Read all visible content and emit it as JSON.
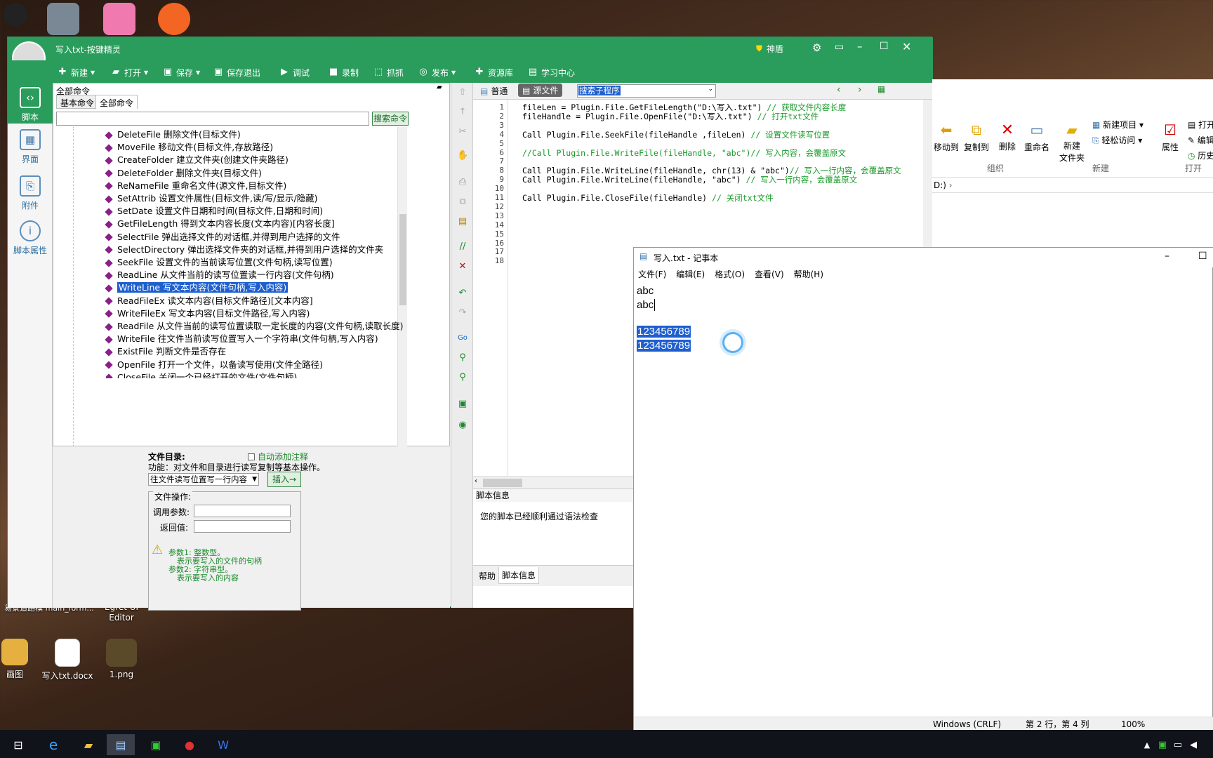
{
  "desktop": {
    "icons": [
      {
        "label": "画图"
      },
      {
        "label": "写入txt.docx"
      },
      {
        "label": "1.png"
      },
      {
        "label": "Egret UI Editor"
      },
      {
        "label": "易景道路模 main_form..."
      }
    ]
  },
  "app": {
    "title": "写入txt-按键精灵",
    "shield_label": "神盾",
    "toolbar": [
      {
        "label": "新建",
        "icon": "plus-icon"
      },
      {
        "label": "打开",
        "icon": "folder-icon"
      },
      {
        "label": "保存",
        "icon": "save-icon"
      },
      {
        "label": "保存退出",
        "icon": "save-exit-icon"
      },
      {
        "label": "调试",
        "icon": "play-icon"
      },
      {
        "label": "录制",
        "icon": "camera-icon"
      },
      {
        "label": "抓抓",
        "icon": "capture-icon"
      },
      {
        "label": "发布",
        "icon": "publish-icon"
      },
      {
        "label": "资源库",
        "icon": "library-icon"
      },
      {
        "label": "学习中心",
        "icon": "learn-icon"
      }
    ],
    "leftbar": [
      {
        "label": "脚本",
        "icon": "script-icon"
      },
      {
        "label": "界面",
        "icon": "ui-icon"
      },
      {
        "label": "附件",
        "icon": "attachment-icon"
      },
      {
        "label": "脚本属性",
        "icon": "info-icon"
      }
    ],
    "cmd_panel": {
      "header": "全部命令",
      "tabs": [
        "基本命令",
        "全部命令"
      ],
      "search_button": "搜索命令",
      "search_value": "",
      "items": [
        "DeleteFile 删除文件(目标文件)",
        "MoveFile 移动文件(目标文件,存放路径)",
        "CreateFolder 建立文件夹(创建文件夹路径)",
        "DeleteFolder 删除文件夹(目标文件)",
        "ReNameFile 重命名文件(源文件,目标文件)",
        "SetAttrib 设置文件属性(目标文件,读/写/显示/隐藏)",
        "SetDate 设置文件日期和时间(目标文件,日期和时间)",
        "GetFileLength 得到文本内容长度(文本内容)[内容长度]",
        "SelectFile 弹出选择文件的对话框,并得到用户选择的文件",
        "SelectDirectory 弹出选择文件夹的对话框,并得到用户选择的文件夹",
        "SeekFile 设置文件的当前读写位置(文件句柄,读写位置)",
        "ReadLine 从文件当前的读写位置读一行内容(文件句柄)",
        "WriteLine 写文本内容(文件句柄,写入内容)",
        "ReadFileEx 读文本内容(目标文件路径)[文本内容]",
        "WriteFileEx 写文本内容(目标文件路径,写入内容)",
        "ReadFile 从文件当前的读写位置读取一定长度的内容(文件句柄,读取长度)",
        "WriteFile 往文件当前读写位置写入一个字符串(文件句柄,写入内容)",
        "ExistFile 判断文件是否存在",
        "OpenFile 打开一个文件，以备读写使用(文件全路径)",
        "CloseFile 关闭一个已经打开的文件(文件句柄)"
      ],
      "selected_index": 12
    },
    "props": {
      "dir_label": "文件目录:",
      "func_label": "功能：对文件和目录进行读写复制等基本操作。",
      "auto_comment": "自动添加注释",
      "select_value": "往文件读写位置写一行内容",
      "insert_button": "插入→",
      "group_label": "文件操作:",
      "param_label": "调用参数:",
      "return_label": "返回值:",
      "hints": [
        "参数1: 整数型。",
        "表示要写入的文件的句柄",
        "参数2: 字符串型。",
        "表示要写入的内容"
      ]
    },
    "editor": {
      "tabs": [
        "普通",
        "源文件"
      ],
      "dropdown": "搜索子程序",
      "lines": [
        {
          "n": "1",
          "code": "fileLen = Plugin.File.GetFileLength(\"D:\\写入.txt\")",
          "cm": " // 获取文件内容长度"
        },
        {
          "n": "2",
          "code": "fileHandle = Plugin.File.OpenFile(\"D:\\写入.txt\")",
          "cm": " // 打开txt文件"
        },
        {
          "n": "3",
          "code": "",
          "cm": ""
        },
        {
          "n": "4",
          "code": "Call Plugin.File.SeekFile(fileHandle ,fileLen)",
          "cm": " // 设置文件读写位置"
        },
        {
          "n": "5",
          "code": "",
          "cm": ""
        },
        {
          "n": "6",
          "code": "",
          "cm": "//Call Plugin.File.WriteFile(fileHandle, \"abc\")// 写入内容，会覆盖原文"
        },
        {
          "n": "7",
          "code": "",
          "cm": ""
        },
        {
          "n": "8",
          "code": "Call Plugin.File.WriteLine(fileHandle, chr(13) & \"abc\")",
          "cm": "// 写入一行内容，会覆盖原文"
        },
        {
          "n": "9",
          "code": "Call Plugin.File.WriteLine(fileHandle, \"abc\")",
          "cm": " // 写入一行内容，会覆盖原文"
        },
        {
          "n": "10",
          "code": "",
          "cm": ""
        },
        {
          "n": "11",
          "code": "Call Plugin.File.CloseFile(fileHandle)",
          "cm": " // 关闭txt文件"
        },
        {
          "n": "12",
          "code": "",
          "cm": ""
        },
        {
          "n": "13",
          "code": "",
          "cm": ""
        },
        {
          "n": "14",
          "code": "",
          "cm": ""
        },
        {
          "n": "15",
          "code": "",
          "cm": ""
        },
        {
          "n": "16",
          "code": "",
          "cm": ""
        },
        {
          "n": "17",
          "code": "",
          "cm": ""
        },
        {
          "n": "18",
          "code": "",
          "cm": ""
        }
      ]
    },
    "script_info": {
      "header": "脚本信息",
      "message": "您的脚本已经顺利通过语法检查",
      "bottom_tabs": [
        "帮助",
        "脚本信息"
      ]
    }
  },
  "explorer": {
    "buttons": [
      "移动到",
      "复制到",
      "删除",
      "重命名",
      "新建\n文件夹",
      "属性"
    ],
    "small": [
      "新建项目",
      "轻松访问",
      "打开",
      "编辑",
      "历史"
    ],
    "groups": [
      "组织",
      "新建",
      "打开"
    ],
    "path": "D:)"
  },
  "notepad": {
    "title": "写入.txt - 记事本",
    "menu": [
      "文件(F)",
      "编辑(E)",
      "格式(O)",
      "查看(V)",
      "帮助(H)"
    ],
    "lines": [
      "abc",
      "abc",
      "",
      "123456789",
      "123456789"
    ],
    "status": {
      "eol": "Windows (CRLF)",
      "pos": "第 2 行，第 4 列",
      "zoom": "100%"
    }
  }
}
